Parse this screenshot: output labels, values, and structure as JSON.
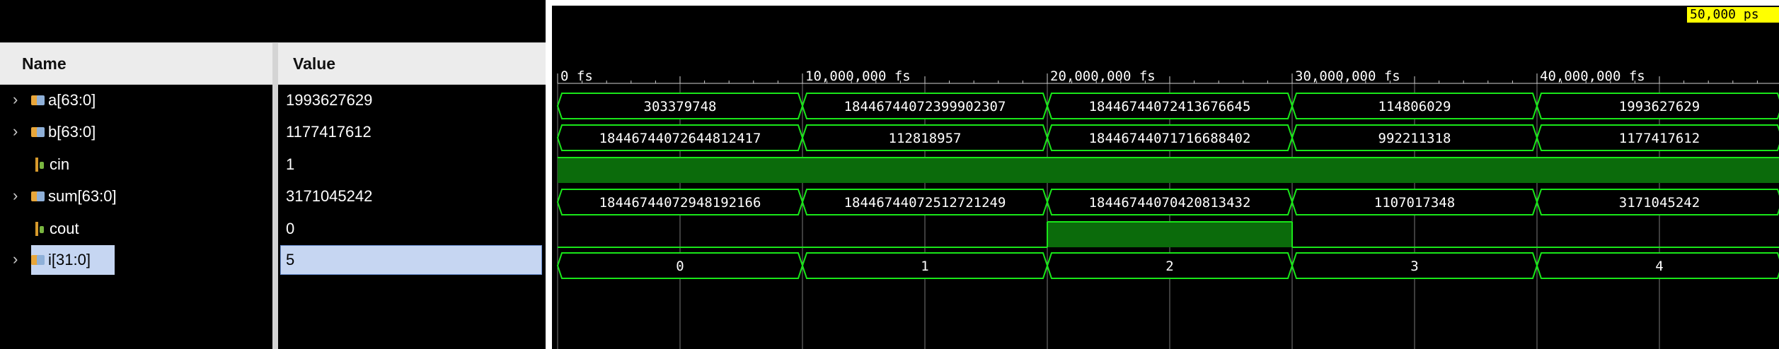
{
  "header": {
    "name_label": "Name",
    "value_label": "Value"
  },
  "cursor_time": "50,000 ps",
  "timeline_ticks": [
    "0 fs",
    "10,000,000 fs",
    "20,000,000 fs",
    "30,000,000 fs",
    "40,000,000 fs"
  ],
  "signals": [
    {
      "name": "a[63:0]",
      "value": "1993627629",
      "type": "bus",
      "expandable": true,
      "segments": [
        "303379748",
        "18446744072399902307",
        "18446744072413676645",
        "114806029",
        "1993627629"
      ]
    },
    {
      "name": "b[63:0]",
      "value": "1177417612",
      "type": "bus",
      "expandable": true,
      "segments": [
        "18446744072644812417",
        "112818957",
        "18446744071716688402",
        "992211318",
        "1177417612"
      ]
    },
    {
      "name": "cin",
      "value": "1",
      "type": "bit",
      "expandable": false,
      "levels": [
        1,
        1,
        1,
        1,
        1
      ]
    },
    {
      "name": "sum[63:0]",
      "value": "3171045242",
      "type": "bus",
      "expandable": true,
      "segments": [
        "18446744072948192166",
        "18446744072512721249",
        "18446744070420813432",
        "1107017348",
        "3171045242"
      ]
    },
    {
      "name": "cout",
      "value": "0",
      "type": "bit",
      "expandable": false,
      "levels": [
        0,
        0,
        1,
        0,
        0
      ]
    },
    {
      "name": "i[31:0]",
      "value": "5",
      "type": "bus",
      "expandable": true,
      "selected": true,
      "segments": [
        "0",
        "1",
        "2",
        "3",
        "4"
      ]
    }
  ],
  "colors": {
    "wave": "#19e619",
    "bit_fill": "#0b6b0b",
    "grid": "#7a7a7a",
    "cursor_bg": "#ffff00"
  },
  "icons": {
    "bus": "bus-signal-icon",
    "bit": "bit-signal-icon",
    "expand": "chevron-right-icon"
  }
}
